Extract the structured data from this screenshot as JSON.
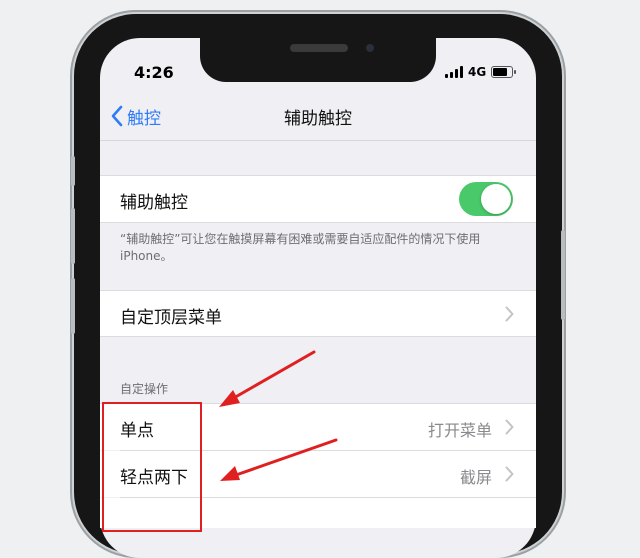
{
  "status_bar": {
    "time": "4:26",
    "network": "4G"
  },
  "nav": {
    "back_label": "触控",
    "title": "辅助触控"
  },
  "assistive_touch": {
    "label": "辅助触控",
    "enabled": true,
    "footnote": "“辅助触控”可让您在触摸屏幕有困难或需要自适应配件的情况下使用iPhone。"
  },
  "top_menu": {
    "label": "自定顶层菜单"
  },
  "custom_actions": {
    "header": "自定操作",
    "rows": [
      {
        "label": "单点",
        "value": "打开菜单"
      },
      {
        "label": "轻点两下",
        "value": "截屏"
      }
    ]
  },
  "colors": {
    "accent": "#2f7cf6",
    "toggle_on": "#4ac96a",
    "annotation": "#e02020"
  },
  "icons": [
    "back-chevron-icon",
    "signal-icon",
    "battery-icon",
    "chevron-right-icon",
    "arrow-icon"
  ]
}
